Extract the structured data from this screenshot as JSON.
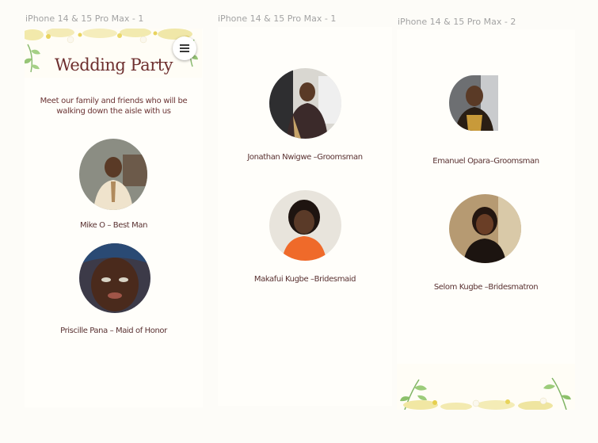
{
  "frames": [
    {
      "label": "iPhone 14 & 15 Pro Max - 1"
    },
    {
      "label": "iPhone 14 & 15 Pro Max - 1"
    },
    {
      "label": "iPhone 14 & 15 Pro Max - 2"
    }
  ],
  "page": {
    "title": "Wedding Party",
    "intro": "Meet our family and friends who will be walking down the aisle with us",
    "menu_icon": "hamburger-menu-icon"
  },
  "members": [
    {
      "caption": "Mike O – Best Man"
    },
    {
      "caption": "Priscille Pana – Maid of Honor"
    },
    {
      "caption": "Jonathan Nwigwe –Groomsman"
    },
    {
      "caption": "Makafui Kugbe –Bridesmaid"
    },
    {
      "caption": "Emanuel Opara–Groomsman"
    },
    {
      "caption": "Selom Kugbe –Bridesmatron"
    }
  ],
  "colors": {
    "accent": "#6e2f2f",
    "background": "#fdfcf8",
    "floral_green": "#8fbf6a",
    "floral_yellow": "#e8d86a"
  }
}
